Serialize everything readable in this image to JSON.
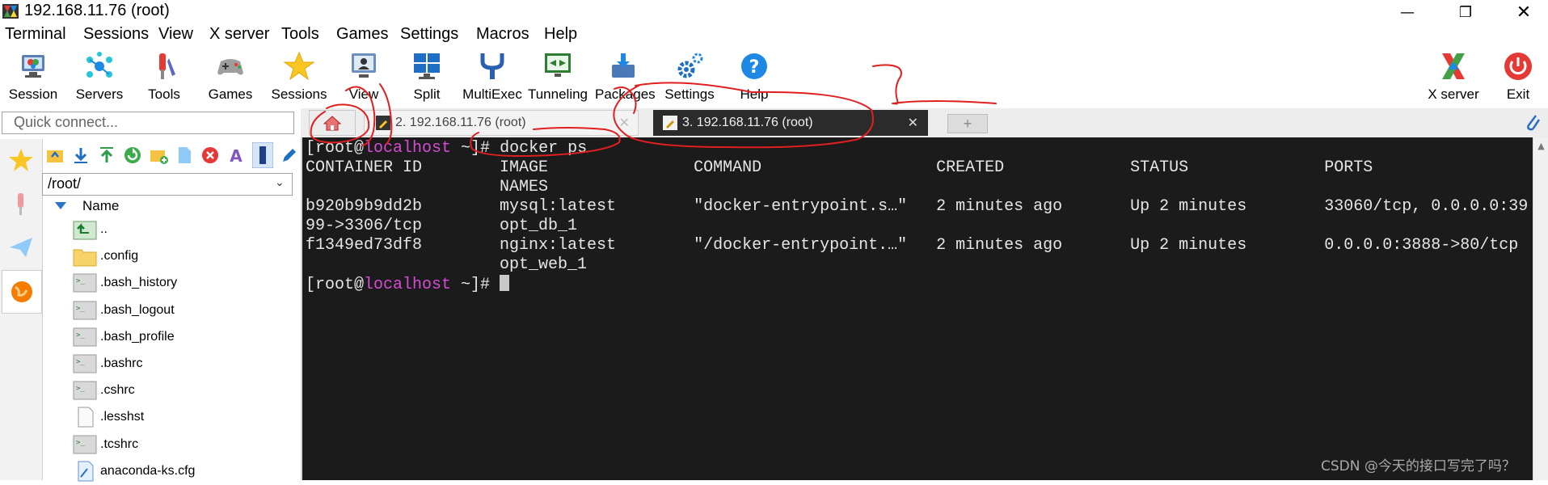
{
  "window": {
    "title": "192.168.11.76 (root)",
    "controls": [
      "minimize-icon",
      "maximize-icon",
      "close-icon"
    ]
  },
  "menu": [
    "Terminal",
    "Sessions",
    "View",
    "X server",
    "Tools",
    "Games",
    "Settings",
    "Macros",
    "Help"
  ],
  "toolbar": [
    {
      "label": "Session",
      "icon": "session-icon"
    },
    {
      "label": "Servers",
      "icon": "servers-icon"
    },
    {
      "label": "Tools",
      "icon": "tools-icon"
    },
    {
      "label": "Games",
      "icon": "gamepad-icon"
    },
    {
      "label": "Sessions",
      "icon": "star-icon"
    },
    {
      "label": "View",
      "icon": "view-icon"
    },
    {
      "label": "Split",
      "icon": "split-icon"
    },
    {
      "label": "MultiExec",
      "icon": "multiexec-icon"
    },
    {
      "label": "Tunneling",
      "icon": "tunneling-icon"
    },
    {
      "label": "Packages",
      "icon": "packages-icon"
    },
    {
      "label": "Settings",
      "icon": "settings-gear-icon"
    },
    {
      "label": "Help",
      "icon": "help-icon"
    }
  ],
  "toolbar_right": [
    {
      "label": "X server",
      "icon": "xserver-icon"
    },
    {
      "label": "Exit",
      "icon": "power-icon"
    }
  ],
  "quick_connect": {
    "placeholder": "Quick connect..."
  },
  "tabs": [
    {
      "label": "2. 192.168.11.76 (root)",
      "active": false
    },
    {
      "label": "3. 192.168.11.76 (root)",
      "active": true
    }
  ],
  "sidebar": {
    "path": "/root/",
    "column_header": "Name",
    "files": [
      {
        "name": "..",
        "icon": "parent-folder-icon"
      },
      {
        "name": ".config",
        "icon": "folder-icon"
      },
      {
        "name": ".bash_history",
        "icon": "script-file-icon"
      },
      {
        "name": ".bash_logout",
        "icon": "script-file-icon"
      },
      {
        "name": ".bash_profile",
        "icon": "script-file-icon"
      },
      {
        "name": ".bashrc",
        "icon": "script-file-icon"
      },
      {
        "name": ".cshrc",
        "icon": "script-file-icon"
      },
      {
        "name": ".lesshst",
        "icon": "text-file-icon"
      },
      {
        "name": ".tcshrc",
        "icon": "script-file-icon"
      },
      {
        "name": "anaconda-ks.cfg",
        "icon": "config-file-icon"
      }
    ]
  },
  "terminal": {
    "prompt_open": "[root@",
    "prompt_host": "localhost",
    "prompt_close": " ~]# ",
    "command": "docker ps",
    "lines": [
      "CONTAINER ID        IMAGE               COMMAND                  CREATED             STATUS              PORTS",
      "                    NAMES",
      "b920b9b9dd2b        mysql:latest        \"docker-entrypoint.s…\"   2 minutes ago       Up 2 minutes        33060/tcp, 0.0.0.0:39",
      "99->3306/tcp        opt_db_1",
      "f1349ed73df8        nginx:latest        \"/docker-entrypoint.…\"   2 minutes ago       Up 2 minutes        0.0.0.0:3888->80/tcp",
      "                    opt_web_1"
    ],
    "final_prompt_close": " ~]# "
  },
  "watermark": "CSDN @今天的接口写完了吗？",
  "colors": {
    "terminal_bg": "#1b1b1b",
    "prompt_host": "#d54bd5",
    "annotation_red": "#e02020"
  }
}
